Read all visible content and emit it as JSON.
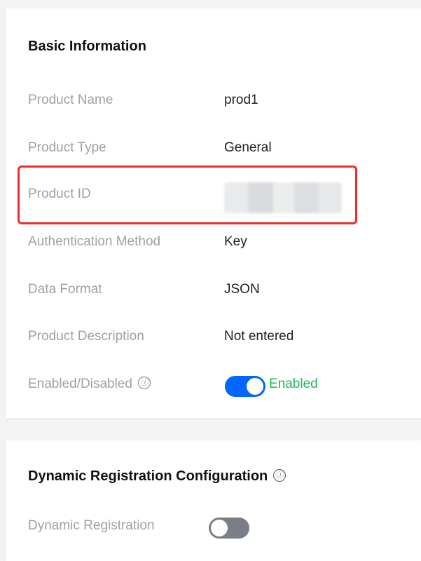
{
  "basic_info": {
    "title": "Basic Information",
    "fields": [
      {
        "label": "Product Name",
        "value": "prod1"
      },
      {
        "label": "Product Type",
        "value": "General"
      },
      {
        "label": "Product ID",
        "value": ""
      },
      {
        "label": "Authentication Method",
        "value": "Key"
      },
      {
        "label": "Data Format",
        "value": "JSON"
      },
      {
        "label": "Product Description",
        "value": "Not entered"
      }
    ],
    "enabled": {
      "label": "Enabled/Disabled",
      "status": "Enabled",
      "on": true
    }
  },
  "dynamic_registration": {
    "title": "Dynamic Registration Configuration",
    "field_label": "Dynamic Registration",
    "on": false
  },
  "icons": {
    "info": "ⓘ"
  },
  "colors": {
    "toggle_on": "#0066ff",
    "toggle_off": "#7a7f87",
    "enabled_text": "#19b956",
    "highlight": "#ee2b2b"
  }
}
